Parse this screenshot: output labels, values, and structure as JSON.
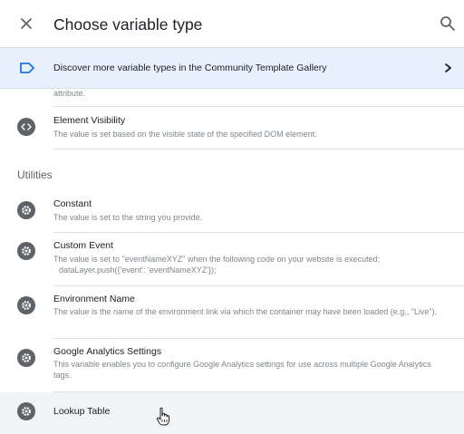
{
  "header": {
    "title": "Choose variable type",
    "close_icon": "close-icon",
    "search_icon": "search-icon"
  },
  "banner": {
    "text": "Discover more variable types in the Community Template Gallery",
    "icon": "label-tag-icon",
    "chevron_icon": "chevron-right-icon"
  },
  "list": {
    "partial_prev_desc": "attribute.",
    "top_items": [
      {
        "title": "Element Visibility",
        "description": "The value is set based on the visible state of the specified DOM element.",
        "icon": "code-icon"
      }
    ],
    "section": {
      "label": "Utilities",
      "items": [
        {
          "title": "Constant",
          "description": "The value is set to the string you provide.",
          "icon": "gear-icon"
        },
        {
          "title": "Custom Event",
          "description": "The value is set to \"eventNameXYZ\" when the following code on your website is executed:",
          "code": "dataLayer.push({'event': 'eventNameXYZ'});",
          "icon": "gear-icon"
        },
        {
          "title": "Environment Name",
          "description": "The value is the name of the environment link via which the container may have been loaded (e.g., \"Live\").",
          "icon": "gear-icon"
        },
        {
          "title": "Google Analytics Settings",
          "description": "This variable enables you to configure Google Analytics settings for use across multiple Google Analytics tags.",
          "icon": "gear-icon"
        },
        {
          "title": "Lookup Table",
          "icon": "gear-icon",
          "hovered": true
        }
      ]
    }
  },
  "colors": {
    "banner_bg": "#e8f0fe",
    "banner_icon": "#1a73e8",
    "icon_bg": "#5f6368",
    "hover_bg": "#f1f3f4",
    "divider": "#e0e0e0"
  }
}
